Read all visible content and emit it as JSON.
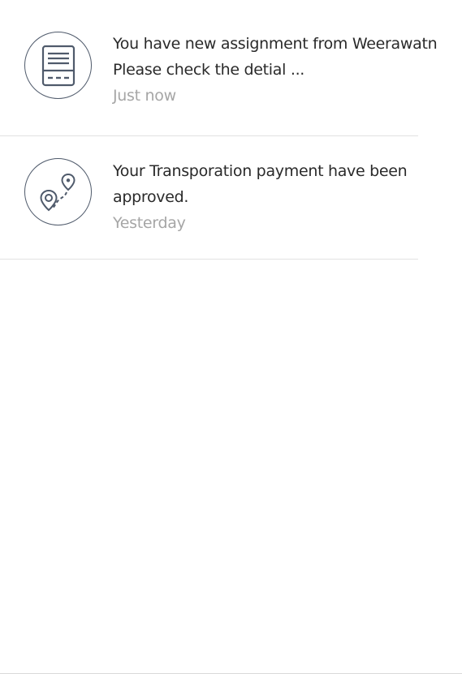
{
  "notifications": [
    {
      "icon": "document-icon",
      "message_lines": [
        "You have new assignment from Weerawatn",
        "Please check the detial ..."
      ],
      "time": "Just now"
    },
    {
      "icon": "route-location-icon",
      "message_lines": [
        "Your Transporation payment have been",
        "approved."
      ],
      "time": "Yesterday"
    }
  ],
  "colors": {
    "icon_stroke": "#4f5a6b",
    "message_text": "#2a2a2a",
    "time_text": "#a6a6a6",
    "divider": "#e2e2e2"
  }
}
